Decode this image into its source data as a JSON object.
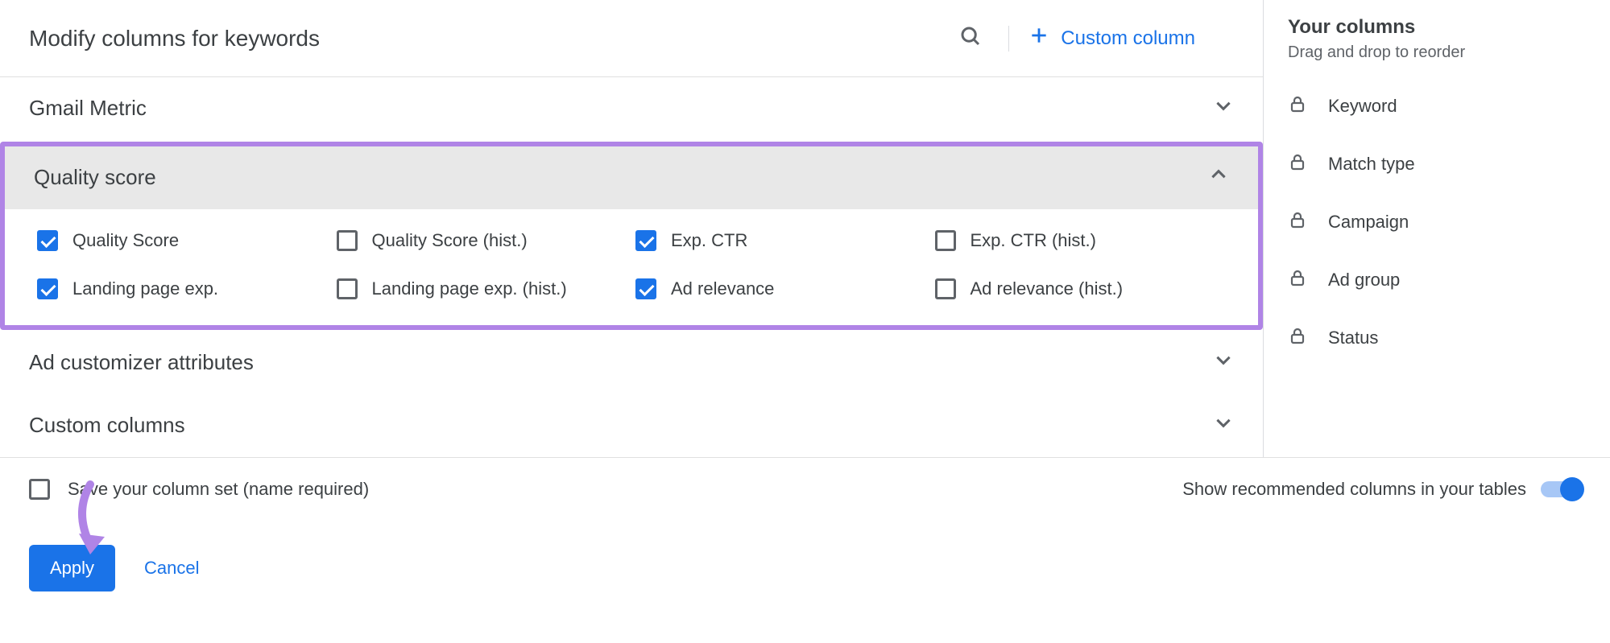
{
  "header": {
    "title": "Modify columns for keywords",
    "custom_column": "Custom column"
  },
  "categories": {
    "gmail": "Gmail Metric",
    "quality": "Quality score",
    "customizer": "Ad customizer attributes",
    "custom_cols": "Custom columns"
  },
  "quality_options": [
    {
      "label": "Quality Score",
      "checked": true
    },
    {
      "label": "Quality Score (hist.)",
      "checked": false
    },
    {
      "label": "Exp. CTR",
      "checked": true
    },
    {
      "label": "Exp. CTR (hist.)",
      "checked": false
    },
    {
      "label": "Landing page exp.",
      "checked": true
    },
    {
      "label": "Landing page exp. (hist.)",
      "checked": false
    },
    {
      "label": "Ad relevance",
      "checked": true
    },
    {
      "label": "Ad relevance (hist.)",
      "checked": false
    }
  ],
  "footer": {
    "save_label": "Save your column set (name required)",
    "apply": "Apply",
    "cancel": "Cancel"
  },
  "recommend_label": "Show recommended columns in your tables",
  "sidebar": {
    "title": "Your columns",
    "subtitle": "Drag and drop to reorder",
    "items": [
      "Keyword",
      "Match type",
      "Campaign",
      "Ad group",
      "Status"
    ]
  }
}
